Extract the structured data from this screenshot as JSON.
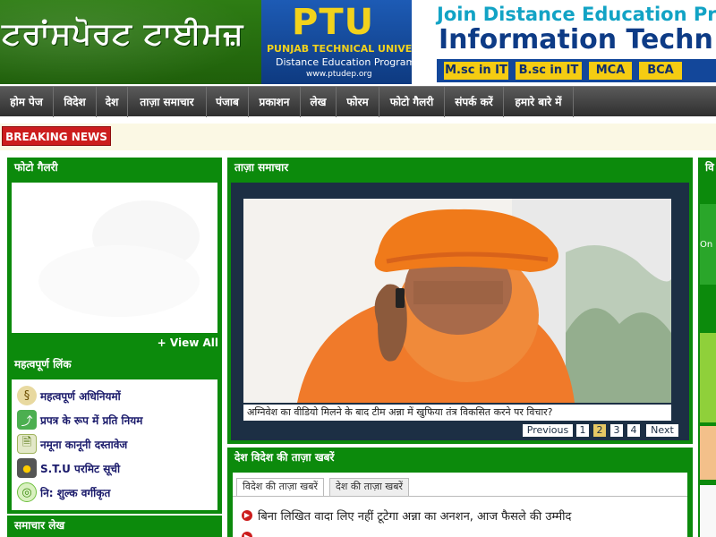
{
  "header": {
    "logo_text": "ਟਰਾਂਸਪੋਰਟ ਟਾਈਮਜ਼"
  },
  "banner": {
    "ptu_logo": "PTU",
    "ptu_name": "PUNJAB TECHNICAL UNIVERSITY",
    "program": "Distance Education Program",
    "url": "www.ptudep.org",
    "line1": "Join Distance Education Pro",
    "line2": "Information Techn",
    "courses": [
      "M.sc in IT",
      "B.sc in IT",
      "MCA",
      "BCA"
    ],
    "colors": {
      "blue": "#13479a",
      "yellow": "#f5cc12"
    }
  },
  "nav": {
    "items": [
      "होम पेज",
      "विदेश",
      "देश",
      "ताज़ा समाचार",
      "पंजाब",
      "प्रकाशन",
      "लेख",
      "फोरम",
      "फोटो गैलरी",
      "संपर्क करें",
      "हमारे बारे में"
    ]
  },
  "breaking": {
    "label": "BREAKING NEWS"
  },
  "gallery": {
    "title": "फोटो गैलरी",
    "view_all": "+ View All"
  },
  "links": {
    "title": "महत्वपूर्ण लिंक",
    "items": [
      {
        "label": "महत्वपूर्ण अधिनियमों",
        "icon": "law-book-icon"
      },
      {
        "label": "प्रपत्र के रूप में प्रति नियम",
        "icon": "share-icon"
      },
      {
        "label": "नमूना कानूनी दस्तावेज",
        "icon": "document-icon"
      },
      {
        "label": "S.T.U परमिट सूची",
        "icon": "traffic-light-icon"
      },
      {
        "label": "नि: शुल्क वर्गीकृत",
        "icon": "globe-icon"
      }
    ]
  },
  "lekh": {
    "title": "समाचार लेख"
  },
  "news": {
    "title": "ताज़ा समाचार",
    "caption": "अग्निवेश का वीडियो मिलने के बाद टीम अन्ना में खुफिया तंत्र विकसित करने पर विचार?",
    "pager": {
      "previous": "Previous",
      "pages": [
        "1",
        "2",
        "3",
        "4"
      ],
      "active_page": "2",
      "next": "Next"
    }
  },
  "world": {
    "title": "देश विदेश की ताज़ा खबरें",
    "tabs": [
      "विदेश की ताज़ा खबरें",
      "देश की ताज़ा खबरें"
    ],
    "items": [
      "बिना लिखित वादा लिए नहीं टूटेगा अन्ना का अनशन, आज फैसले की उम्मीद"
    ]
  },
  "right": {
    "title_fragment": "वि",
    "text_fragment": "On"
  }
}
